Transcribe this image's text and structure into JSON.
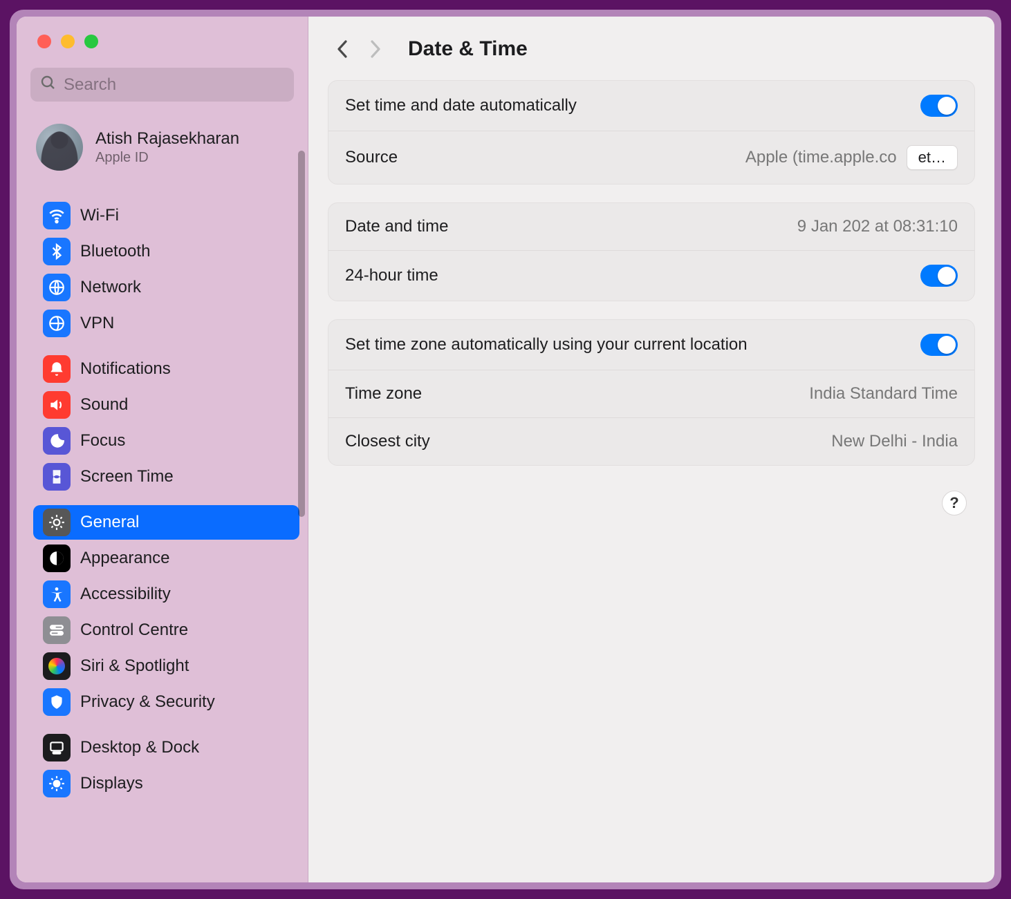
{
  "search": {
    "placeholder": "Search"
  },
  "account": {
    "name": "Atish Rajasekharan",
    "subtitle": "Apple ID"
  },
  "sidebar": {
    "items": [
      {
        "label": "Wi-Fi"
      },
      {
        "label": "Bluetooth"
      },
      {
        "label": "Network"
      },
      {
        "label": "VPN"
      },
      {
        "label": "Notifications"
      },
      {
        "label": "Sound"
      },
      {
        "label": "Focus"
      },
      {
        "label": "Screen Time"
      },
      {
        "label": "General"
      },
      {
        "label": "Appearance"
      },
      {
        "label": "Accessibility"
      },
      {
        "label": "Control Centre"
      },
      {
        "label": "Siri & Spotlight"
      },
      {
        "label": "Privacy & Security"
      },
      {
        "label": "Desktop & Dock"
      },
      {
        "label": "Displays"
      }
    ]
  },
  "page": {
    "title": "Date & Time",
    "group1": {
      "auto_label": "Set time and date automatically",
      "source_label": "Source",
      "source_value": "Apple (time.apple.co",
      "source_button": "et…"
    },
    "group2": {
      "dt_label": "Date and time",
      "dt_value_a": "9 Jan 202",
      "dt_value_b": " at 08:31:10",
      "h24_label": "24-hour time"
    },
    "group3": {
      "tz_auto_label": "Set time zone automatically using your current location",
      "tz_label": "Time zone",
      "tz_value": "India Standard Time",
      "city_label": "Closest city",
      "city_value": "New Delhi - India"
    },
    "help": "?"
  }
}
